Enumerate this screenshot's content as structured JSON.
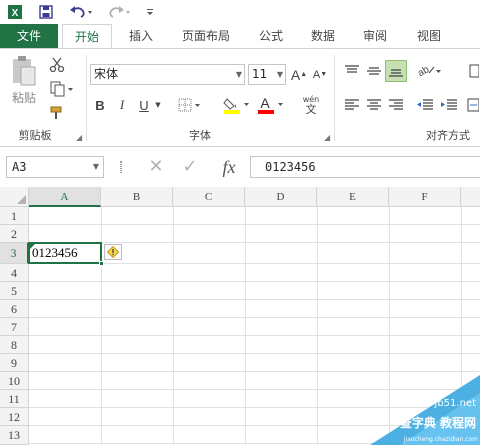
{
  "colors": {
    "accent": "#217346",
    "watermark": "#39a7e0"
  },
  "qat": {
    "excel_icon": "excel-logo-icon",
    "save_icon": "save-icon",
    "undo_icon": "undo-icon",
    "redo_icon": "redo-icon",
    "customize_icon": "customize-qat-icon"
  },
  "tabs": [
    {
      "label": "文件"
    },
    {
      "label": "开始"
    },
    {
      "label": "插入"
    },
    {
      "label": "页面布局"
    },
    {
      "label": "公式"
    },
    {
      "label": "数据"
    },
    {
      "label": "审阅"
    },
    {
      "label": "视图"
    }
  ],
  "ribbon": {
    "clipboard": {
      "label": "剪贴板",
      "paste": "粘贴"
    },
    "font": {
      "label": "字体",
      "name": "宋体",
      "size": "11",
      "grow": "A",
      "shrink": "A",
      "bold": "B",
      "italic": "I",
      "underline": "U",
      "color_letter": "A",
      "wen": "wén",
      "wen_char": "文"
    },
    "align": {
      "label": "对齐方式"
    }
  },
  "formula_bar": {
    "name_box": "A3",
    "cancel": "✕",
    "enter": "✓",
    "fx": "fx",
    "value": "0123456"
  },
  "grid": {
    "columns": [
      "A",
      "B",
      "C",
      "D",
      "E",
      "F"
    ],
    "rows": [
      "1",
      "2",
      "3",
      "4",
      "5",
      "6",
      "7",
      "8",
      "9",
      "10",
      "11",
      "12",
      "13"
    ],
    "active_cell": {
      "ref": "A3",
      "value": "0123456"
    },
    "error_icon": "warning-diamond-icon"
  },
  "watermark": {
    "line1": "查字典 教程网",
    "line2": "jiaocheng.chazidian.com",
    "line3": "jb51.net"
  }
}
